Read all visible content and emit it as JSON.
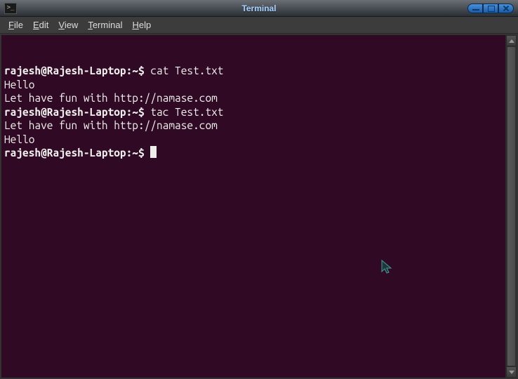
{
  "window": {
    "title": "Terminal"
  },
  "menubar": {
    "items": [
      {
        "label": "File",
        "mnemonic": "F"
      },
      {
        "label": "Edit",
        "mnemonic": "E"
      },
      {
        "label": "View",
        "mnemonic": "V"
      },
      {
        "label": "Terminal",
        "mnemonic": "T"
      },
      {
        "label": "Help",
        "mnemonic": "H"
      }
    ]
  },
  "terminal": {
    "prompt": "rajesh@Rajesh-Laptop:~$ ",
    "lines": [
      {
        "prompt": true,
        "command": "cat Test.txt"
      },
      {
        "prompt": false,
        "text": "Hello"
      },
      {
        "prompt": false,
        "text": "Let have fun with http://namase.com"
      },
      {
        "prompt": true,
        "command": "tac Test.txt"
      },
      {
        "prompt": false,
        "text": "Let have fun with http://namase.com"
      },
      {
        "prompt": false,
        "text": "Hello"
      },
      {
        "prompt": true,
        "command": "",
        "cursor": true
      }
    ]
  }
}
